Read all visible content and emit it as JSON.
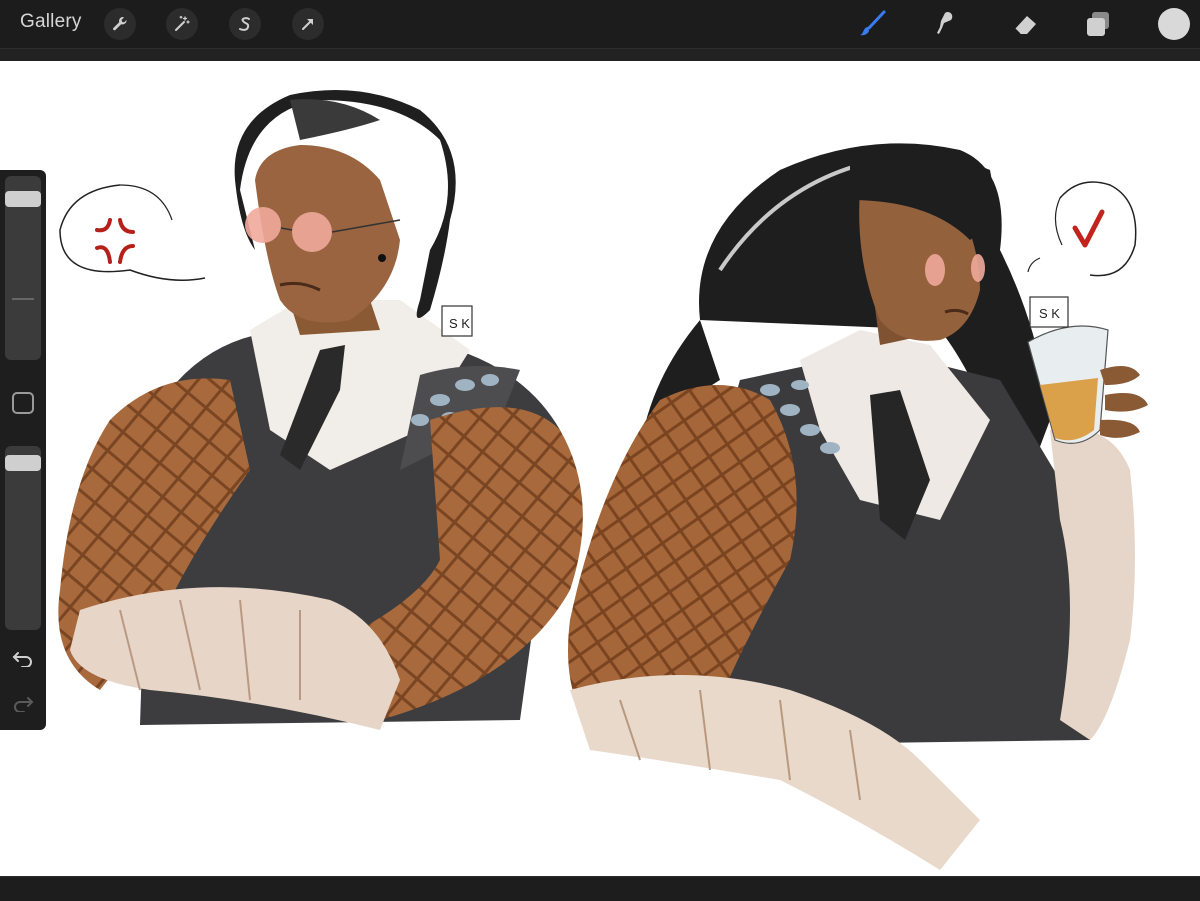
{
  "toolbar": {
    "gallery_label": "Gallery",
    "left_tools": [
      "wrench-icon",
      "magic-wand-icon",
      "selection-s-icon",
      "transform-arrow-icon"
    ],
    "right_tools": [
      "brush-icon",
      "smudge-icon",
      "eraser-icon",
      "layers-icon"
    ],
    "active_tool": "brush-icon",
    "active_color": "#3a7bf5",
    "current_color": "#d9d9d9"
  },
  "sidebar": {
    "brush_size_level": 0.92,
    "opacity_level": 0.96,
    "controls": [
      "modify-button-icon",
      "undo-icon",
      "redo-icon"
    ]
  },
  "artwork": {
    "left_bubble_symbol": "anger-mark",
    "right_bubble_symbol": "heart-check",
    "left_signature": "S K",
    "right_signature": "S K"
  }
}
